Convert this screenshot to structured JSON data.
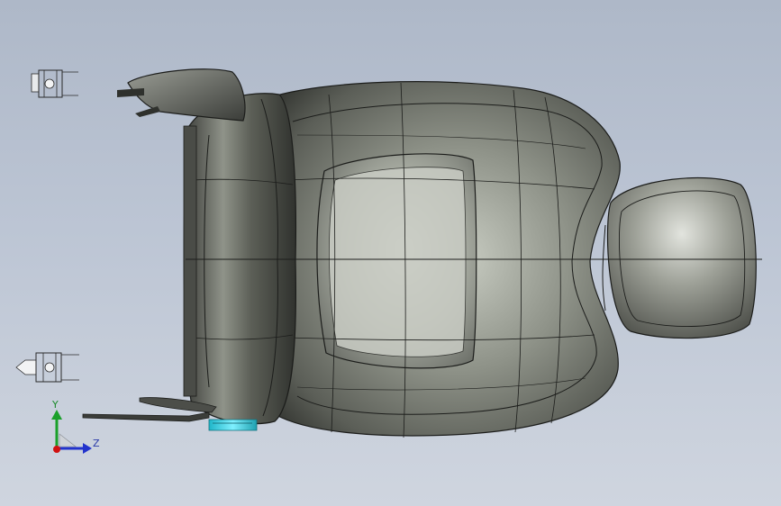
{
  "viewport": {
    "background_top": "#aeb8c8",
    "background_bottom": "#cfd5df",
    "model": "car-seat",
    "view": "top"
  },
  "triad": {
    "y_label": "Y",
    "z_label": "Z",
    "y_color": "#1aa02a",
    "z_color": "#2233cc",
    "origin_color": "#d01010"
  }
}
